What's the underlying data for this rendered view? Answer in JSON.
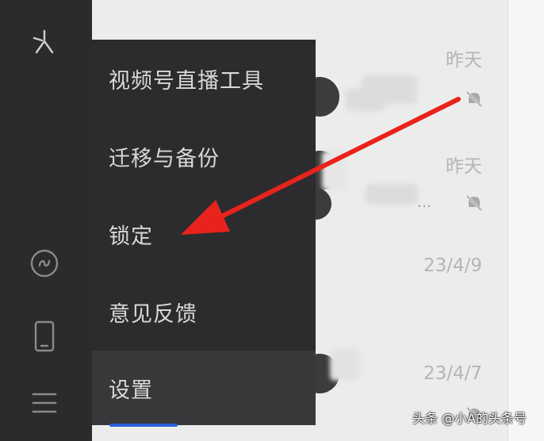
{
  "menu": {
    "items": [
      {
        "label": "视频号直播工具"
      },
      {
        "label": "迁移与备份"
      },
      {
        "label": "锁定"
      },
      {
        "label": "意见反馈"
      },
      {
        "label": "设置"
      }
    ]
  },
  "chats": [
    {
      "time": "昨天"
    },
    {
      "time": "昨天"
    },
    {
      "time": "23/4/9"
    },
    {
      "time": "23/4/7"
    }
  ],
  "sidebar": {
    "icons": [
      "logo-icon",
      "mini-program-icon",
      "phone-icon",
      "menu-icon"
    ]
  },
  "annotation": {
    "arrow_color": "#e8231c"
  },
  "watermark": "头条 @小A的头条号"
}
